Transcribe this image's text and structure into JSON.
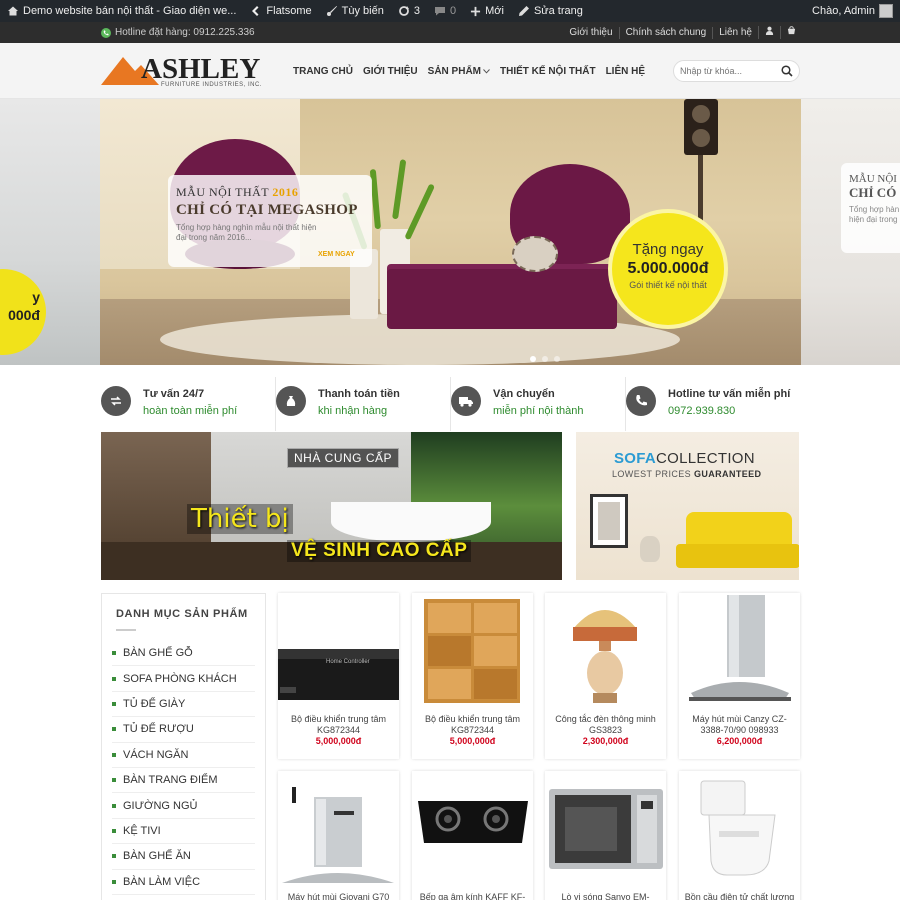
{
  "adminbar": {
    "site_title": "Demo website bán nội thất - Giao diện we...",
    "theme": "Flatsome",
    "customize": "Tùy biến",
    "updates_count": "3",
    "comments_count": "0",
    "new_label": "Mới",
    "edit_label": "Sửa trang",
    "greeting": "Chào, Admin"
  },
  "topbar": {
    "hotline": "Hotline đặt hàng: 0912.225.336",
    "links": [
      "Giới thiệu",
      "Chính sách chung",
      "Liên hệ"
    ]
  },
  "header": {
    "logo_word": "ASHLEY",
    "logo_sub": "FURNITURE INDUSTRIES, INC.",
    "nav": [
      "TRANG CHỦ",
      "GIỚI THIỆU",
      "SẢN PHẨM",
      "THIẾT KẾ NỘI THẤT",
      "LIÊN HỆ"
    ],
    "search_placeholder": "Nhập từ khóa..."
  },
  "slider": {
    "promo_prefix": "MẪU NỘI THẤT ",
    "promo_year": "2016",
    "promo_title": "CHỈ CÓ TẠI MEGASHOP",
    "promo_desc": "Tổng hợp hàng nghìn mẫu nội thất hiện đại trong năm 2016...",
    "promo_cta": "XEM NGAY",
    "gift_line1": "Tặng ngay",
    "gift_amount": "5.000.000đ",
    "gift_line3": "Gói thiết kế nội thất",
    "left_peek_amount": "000đ",
    "left_peek_text": "y",
    "right_peek_line1": "MẪU NỘI",
    "right_peek_line2": "CHỈ CÓ",
    "right_peek_desc": "Tổng hợp hàn hiện đại trong"
  },
  "features": [
    {
      "title": "Tư vấn 24/7",
      "sub": "hoàn toàn miễn phí",
      "icon": "exchange-icon"
    },
    {
      "title": "Thanh toán tiền",
      "sub": "khi nhận hàng",
      "icon": "money-bag-icon"
    },
    {
      "title": "Vận chuyển",
      "sub": "miễn phí nội thành",
      "icon": "truck-icon"
    },
    {
      "title": "Hotline tư vấn miễn phí",
      "sub": "0972.939.830",
      "icon": "phone-icon"
    }
  ],
  "banner1": {
    "tag": "NHÀ CUNG CẤP",
    "big": "Thiết bị",
    "sub": "VỆ SINH CAO CẤP"
  },
  "banner2": {
    "title_accent": "SOFA",
    "title_rest": "COLLECTION",
    "sub_plain": "LOWEST PRICES ",
    "sub_bold": "GUARANTEED"
  },
  "sidebar": {
    "title": "DANH MỤC SẢN PHẨM",
    "items": [
      "BÀN GHẾ GỖ",
      "SOFA PHÒNG KHÁCH",
      "TỦ ĐỂ GIÀY",
      "TỦ ĐỂ RƯỢU",
      "VÁCH NGĂN",
      "BÀN TRANG ĐIỂM",
      "GIƯỜNG NGỦ",
      "KỆ TIVI",
      "BÀN GHẾ ĂN",
      "BÀN LÀM VIỆC"
    ]
  },
  "products": [
    {
      "name": "Bộ điều khiển trung tâm KG872344",
      "price": "5,000,000đ",
      "label": "Home Controller"
    },
    {
      "name": "Bộ điều khiển trung tâm KG872344",
      "price": "5,000,000đ"
    },
    {
      "name": "Công tắc đèn thông minh GS3823",
      "price": "2,300,000đ"
    },
    {
      "name": "Máy hút mùi Canzy CZ-3388-70/90 098933",
      "price": "6,200,000đ"
    },
    {
      "name": "Máy hút mùi Giovani G70",
      "price": ""
    },
    {
      "name": "Bếp ga âm kính KAFF KF-",
      "price": ""
    },
    {
      "name": "Lò vi sóng Sanyo EM-",
      "price": ""
    },
    {
      "name": "Bồn cầu điện tử chất lượng",
      "price": ""
    }
  ],
  "colors": {
    "adminbar": "#23282d",
    "topbar": "#2d2d2d",
    "accent_orange": "#e87722",
    "green": "#2e8b2e",
    "price_red": "#d0021b",
    "yellow": "#f5e61c"
  }
}
